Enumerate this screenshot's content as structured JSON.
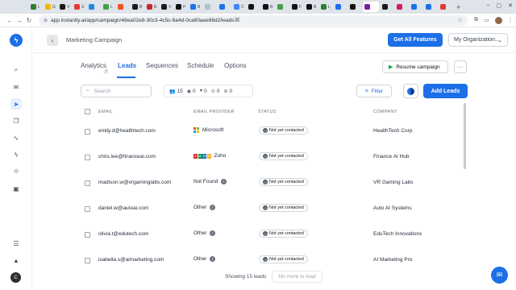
{
  "browser": {
    "tabs": [
      {
        "letter": "L",
        "color": "#2e7d32"
      },
      {
        "letter": "G",
        "color": "#f6b400"
      },
      {
        "letter": "V",
        "color": "#1a1a1a"
      },
      {
        "letter": "S",
        "color": "#e53935"
      },
      {
        "letter": "",
        "color": "#1e88e5"
      },
      {
        "letter": "L",
        "color": "#43a047"
      },
      {
        "letter": "",
        "color": "#f4511e"
      },
      {
        "letter": "B",
        "color": "#1a1a1a"
      },
      {
        "letter": "B",
        "color": "#c62828"
      },
      {
        "letter": "V",
        "color": "#1a1a1a"
      },
      {
        "letter": "P",
        "color": "#111111"
      },
      {
        "letter": "B",
        "color": "#1a73e8"
      },
      {
        "letter": "",
        "color": "#b0bec5"
      },
      {
        "letter": "",
        "color": "#1a73e8"
      },
      {
        "letter": "C",
        "color": "#4285f4"
      },
      {
        "letter": "",
        "color": "#111111"
      },
      {
        "letter": "B",
        "color": "#111111"
      },
      {
        "letter": "",
        "color": "#43a047"
      },
      {
        "letter": "F",
        "color": "#111111"
      },
      {
        "letter": "B",
        "color": "#111111"
      },
      {
        "letter": "L",
        "color": "#2e7d32"
      },
      {
        "letter": "",
        "color": "#1d6fe8"
      },
      {
        "letter": "",
        "color": "#111111"
      },
      {
        "letter": "",
        "color": "#7b1fa2"
      },
      {
        "letter": "",
        "color": "#1a1a1a"
      },
      {
        "letter": "",
        "color": "#d81b60"
      },
      {
        "letter": "",
        "color": "#1a73e8"
      },
      {
        "letter": "",
        "color": "#1a73e8"
      },
      {
        "letter": "",
        "color": "#e53935"
      }
    ],
    "url": "app.instantly.ai/app/campaign/48ea02e8-30c3-4c5c-8a4d-0ca60aee86d2/leads"
  },
  "header": {
    "campaign_title": "Marketing Campaign",
    "features_button": "Get All Features",
    "org_select": "My Organization..."
  },
  "subtabs": [
    "Analytics",
    "Leads",
    "Sequences",
    "Schedule",
    "Options"
  ],
  "actions": {
    "resume_button": "Resume campaign",
    "more_button": "···"
  },
  "toolbar": {
    "search_placeholder": "Search",
    "stats": [
      "15",
      "0",
      "0",
      "0",
      "0"
    ],
    "filter_button": "Filter",
    "add_leads_button": "Add Leads"
  },
  "table": {
    "columns": [
      "EMAIL",
      "EMAIL PROVIDER",
      "STATUS",
      "COMPANY"
    ],
    "rows": [
      {
        "email": "emily.d@healthtech.com",
        "provider": "Microsoft",
        "status": "Not yet contacted",
        "company": "HealthTech Corp."
      },
      {
        "email": "chris.lee@financeai.com",
        "provider": "Zoho",
        "status": "Not yet contacted",
        "company": "Finance AI Hub"
      },
      {
        "email": "madison.w@vrgaminglabs.com",
        "provider": "Not Found",
        "status": "Not yet contacted",
        "company": "VR Gaming Labs"
      },
      {
        "email": "daniel.w@autoai.com",
        "provider": "Other",
        "status": "Not yet contacted",
        "company": "Auto AI Systems"
      },
      {
        "email": "olivia.t@edutech.com",
        "provider": "Other",
        "status": "Not yet contacted",
        "company": "EduTech Innovations"
      },
      {
        "email": "isabella.s@aimarketing.com",
        "provider": "Other",
        "status": "Not yet contacted",
        "company": "AI Marketing Pro"
      }
    ]
  },
  "footer": {
    "count_text": "Showing 15 leads",
    "no_more_button": "No more to load"
  }
}
